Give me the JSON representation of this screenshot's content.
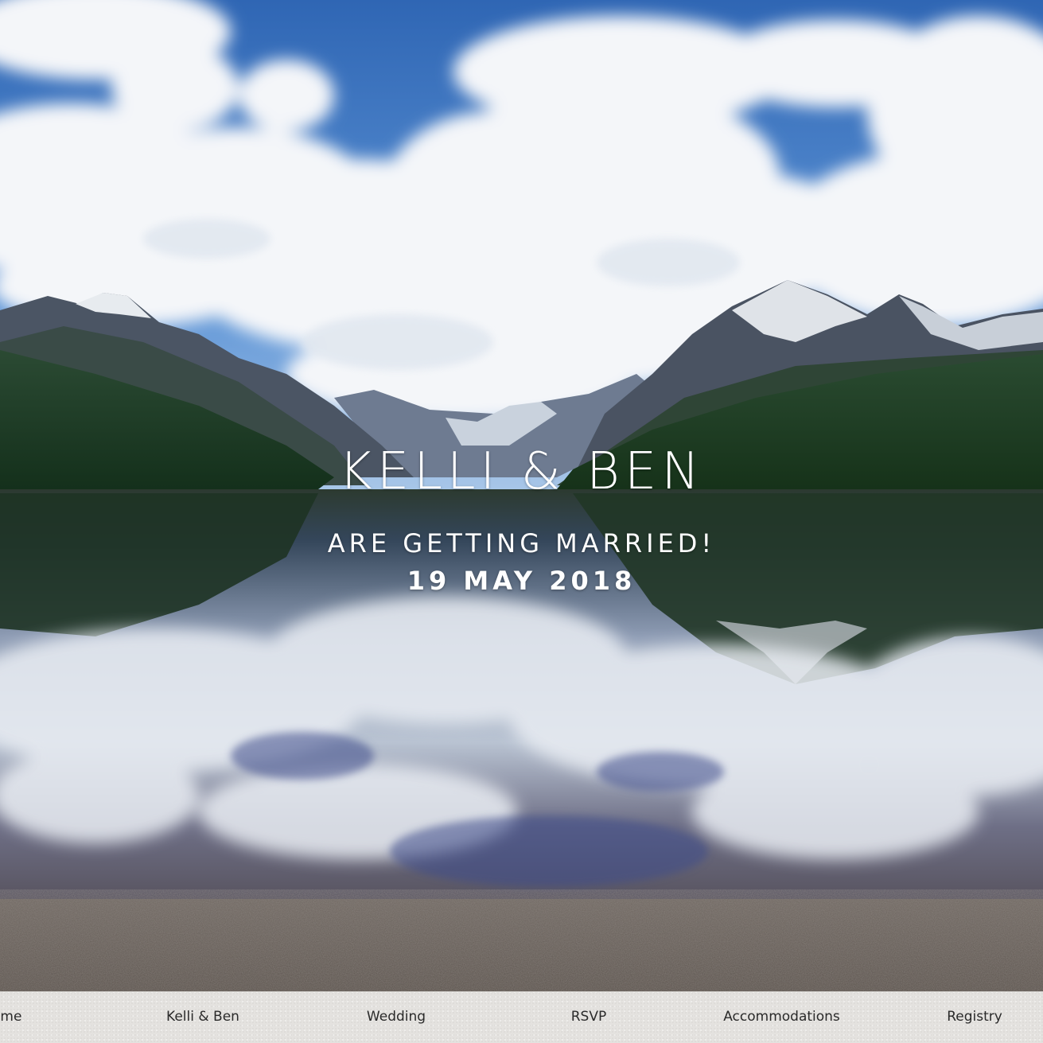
{
  "hero": {
    "couple_names": "KELLI & BEN",
    "tagline": "ARE GETTING MARRIED!",
    "date": "19 MAY 2018",
    "image_subject": "mountain lake with cloud reflections",
    "colors": {
      "sky": "#3f79c4",
      "cloud": "#f3f5f8",
      "forest": "#1d3a22",
      "mountain": "#4a5564",
      "water": "#5d6a7e",
      "shore": "#6b635b"
    }
  },
  "nav": {
    "background": "#e4e2df",
    "items": [
      {
        "label": "Home",
        "visible_label": "ome"
      },
      {
        "label": "Kelli & Ben"
      },
      {
        "label": "Wedding"
      },
      {
        "label": "RSVP"
      },
      {
        "label": "Accommodations"
      },
      {
        "label": "Registry"
      }
    ]
  }
}
